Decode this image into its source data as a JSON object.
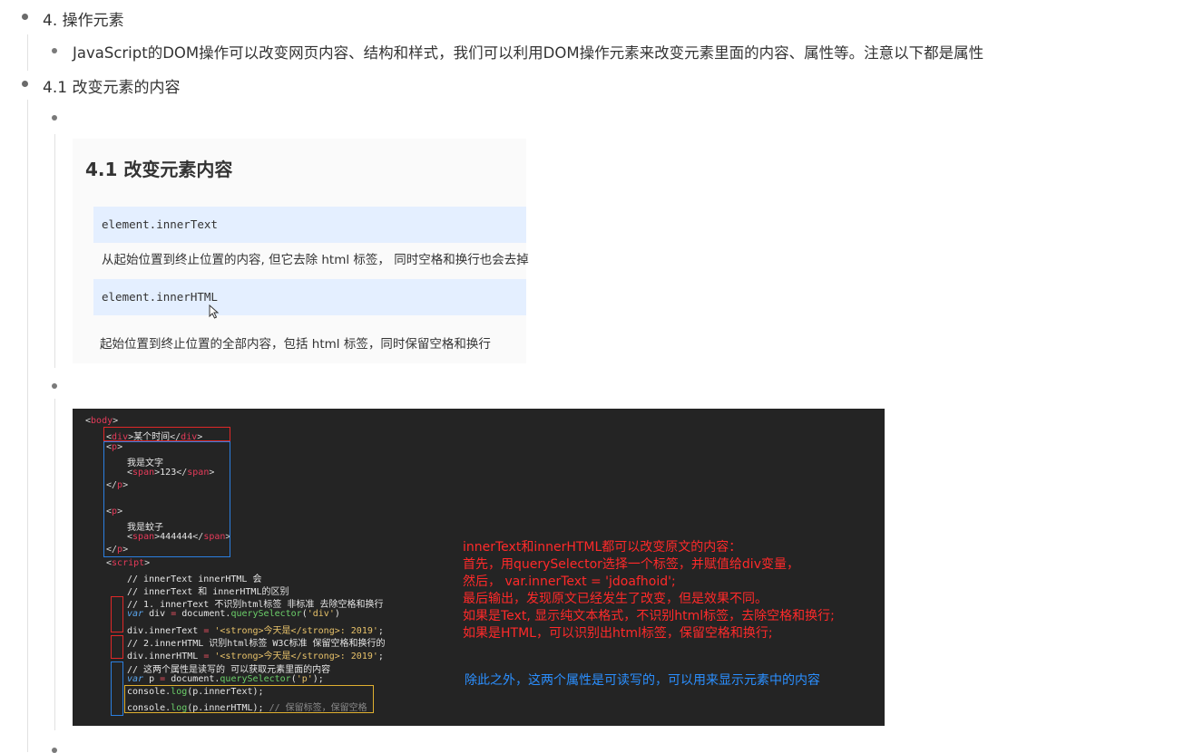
{
  "outline": {
    "item1": "4. 操作元素",
    "item1_sub": "JavaScript的DOM操作可以改变网页内容、结构和样式，我们可以利用DOM操作元素来改变元素里面的内容、属性等。注意以下都是属性",
    "item2": "4.1 改变元素的内容"
  },
  "doc_shot": {
    "heading": "4.1 改变元素内容",
    "code1": "element.innerText",
    "desc1": "从起始位置到终止位置的内容, 但它去除 html 标签， 同时空格和换行也会去掉",
    "code2": "element.innerHTML",
    "desc2": "起始位置到终止位置的全部内容，包括 html 标签，同时保留空格和换行"
  },
  "code_shot": {
    "lines": {
      "l1_tag": "body",
      "l2_tag": "div",
      "l2_text": "某个时间",
      "l3_tag": "p",
      "l4_text": "我是文字",
      "l5_tag": "span",
      "l5_text": "123",
      "l6_tag": "p",
      "l7_tag": "p",
      "l8_text": "我是蚊子",
      "l9_tag": "span",
      "l9_text": "444444",
      "l10_tag": "p",
      "l11_tag": "script",
      "c1": "// innerText innerHTML 会",
      "c2": "// innerText 和 innerHTML的区别",
      "c3": "// 1. innerText 不识别html标签 非标准  去除空格和换行",
      "s1_kw": "var",
      "s1_var": "div",
      "s1_obj": "document.",
      "s1_fn": "querySelector",
      "s1_arg": "'div'",
      "s2_obj": "div.innerText",
      "s2_str": "'<strong>今天是</strong>: 2019'",
      "c4": "// 2.innerHTML  识别html标签  W3C标准 保留空格和换行的",
      "s3_obj": "div.innerHTML",
      "s3_str": "'<strong>今天是</strong>: 2019'",
      "c5": "// 这两个属性是读写的 可以获取元素里面的内容",
      "s4_kw": "var",
      "s4_var": "p",
      "s4_obj": "document.",
      "s4_fn": "querySelector",
      "s4_arg": "'p'",
      "s5_obj": "console.",
      "s5_fn": "log",
      "s5_arg": "(p.innerText);",
      "s6_obj": "console.",
      "s6_fn": "log",
      "s6_arg": "(p.innerHTML);",
      "s6_cmt": "// 保留标签，保留空格"
    },
    "notes_red": [
      "innerText和innerHTML都可以改变原文的内容：",
      "   首先，用querySelector选择一个标签，并赋值给div变量，",
      "   然后，  var.innerText = 'jdoafhoid';",
      "   最后输出，发现原文已经发生了改变，但是效果不同。",
      "如果是Text, 显示纯文本格式，不识别html标签，去除空格和换行;",
      "如果是HTML，可以识别出html标签，保留空格和换行;"
    ],
    "note_blue": "除此之外，这两个属性是可读写的，可以用来显示元素中的内容"
  },
  "colors": {
    "red_note": "#ff2a2a",
    "blue_note": "#2b8fff",
    "tag": "#e63b5a",
    "editor_bg": "#242424"
  }
}
